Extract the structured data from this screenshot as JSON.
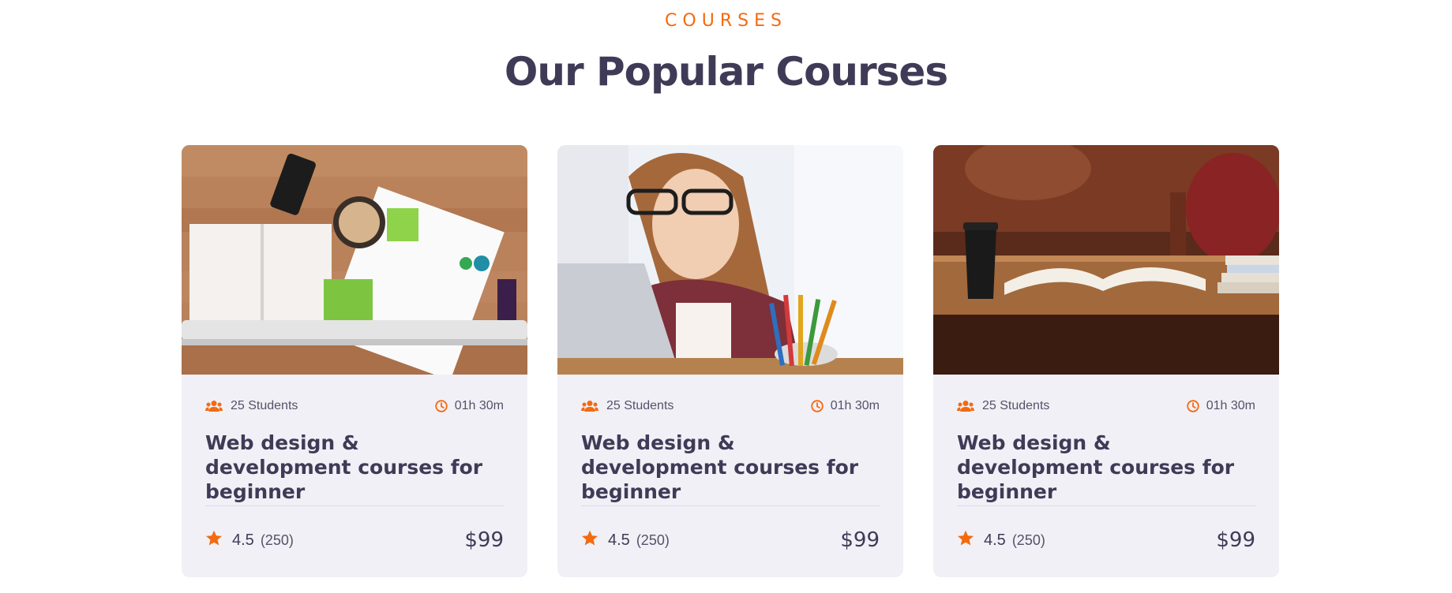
{
  "section": {
    "eyebrow": "COURSES",
    "title": "Our Popular Courses"
  },
  "accent_color": "#f46a0f",
  "cards": [
    {
      "image": "desk-workspace-photo",
      "students": "25 Students",
      "duration": "01h 30m",
      "title": "Web design & development courses for beginner",
      "rating": "4.5",
      "rating_count": "(250)",
      "price": "$99"
    },
    {
      "image": "student-with-laptop-photo",
      "students": "25 Students",
      "duration": "01h 30m",
      "title": "Web design & development courses for beginner",
      "rating": "4.5",
      "rating_count": "(250)",
      "price": "$99"
    },
    {
      "image": "library-book-photo",
      "students": "25 Students",
      "duration": "01h 30m",
      "title": "Web design & development courses for beginner",
      "rating": "4.5",
      "rating_count": "(250)",
      "price": "$99"
    }
  ],
  "icons": {
    "students": "users-icon",
    "duration": "clock-icon",
    "rating": "star-icon"
  }
}
